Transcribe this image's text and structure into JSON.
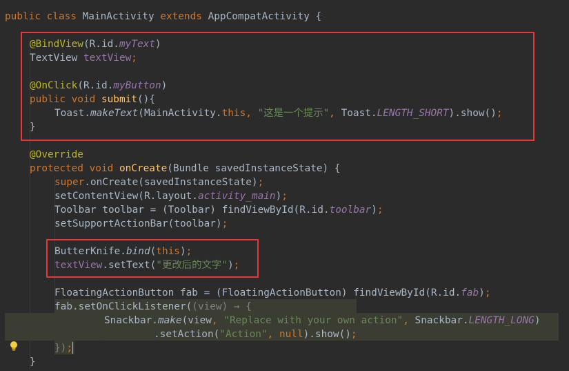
{
  "editor": {
    "lines": [
      {
        "indent": 0,
        "tokens": [
          {
            "t": "public class ",
            "c": "kw"
          },
          {
            "t": "MainActivity ",
            "c": "plain"
          },
          {
            "t": "extends ",
            "c": "kw"
          },
          {
            "t": "AppCompatActivity {",
            "c": "plain"
          }
        ]
      },
      {
        "indent": 0,
        "tokens": []
      },
      {
        "indent": 1,
        "tokens": [
          {
            "t": "@BindView",
            "c": "ann"
          },
          {
            "t": "(R.id.",
            "c": "plain"
          },
          {
            "t": "myText",
            "c": "field"
          },
          {
            "t": ")",
            "c": "plain"
          }
        ]
      },
      {
        "indent": 1,
        "tokens": [
          {
            "t": "TextView ",
            "c": "plain"
          },
          {
            "t": "textView",
            "c": "member"
          },
          {
            "t": ";",
            "c": "kw"
          }
        ]
      },
      {
        "indent": 1,
        "tokens": []
      },
      {
        "indent": 1,
        "tokens": [
          {
            "t": "@OnClick",
            "c": "ann"
          },
          {
            "t": "(R.id.",
            "c": "plain"
          },
          {
            "t": "myButton",
            "c": "field"
          },
          {
            "t": ")",
            "c": "plain"
          }
        ]
      },
      {
        "indent": 1,
        "tokens": [
          {
            "t": "public void ",
            "c": "kw"
          },
          {
            "t": "submit",
            "c": "method"
          },
          {
            "t": "(){",
            "c": "plain"
          }
        ]
      },
      {
        "indent": 2,
        "tokens": [
          {
            "t": "Toast.",
            "c": "plain"
          },
          {
            "t": "makeText",
            "c": "static"
          },
          {
            "t": "(MainActivity.",
            "c": "plain"
          },
          {
            "t": "this",
            "c": "kw"
          },
          {
            "t": ", ",
            "c": "kw"
          },
          {
            "t": "\"这是一个提示\"",
            "c": "str"
          },
          {
            "t": ", ",
            "c": "kw"
          },
          {
            "t": "Toast.",
            "c": "plain"
          },
          {
            "t": "LENGTH_SHORT",
            "c": "field"
          },
          {
            "t": ").show()",
            "c": "plain"
          },
          {
            "t": ";",
            "c": "kw"
          }
        ]
      },
      {
        "indent": 1,
        "tokens": [
          {
            "t": "}",
            "c": "plain"
          }
        ]
      },
      {
        "indent": 1,
        "tokens": []
      },
      {
        "indent": 1,
        "tokens": [
          {
            "t": "@Override",
            "c": "ann"
          }
        ]
      },
      {
        "indent": 1,
        "tokens": [
          {
            "t": "protected void ",
            "c": "kw"
          },
          {
            "t": "onCreate",
            "c": "method"
          },
          {
            "t": "(Bundle savedInstanceState) {",
            "c": "plain"
          }
        ]
      },
      {
        "indent": 2,
        "tokens": [
          {
            "t": "super",
            "c": "kw"
          },
          {
            "t": ".onCreate(savedInstanceState)",
            "c": "plain"
          },
          {
            "t": ";",
            "c": "kw"
          }
        ]
      },
      {
        "indent": 2,
        "tokens": [
          {
            "t": "setContentView(R.layout.",
            "c": "plain"
          },
          {
            "t": "activity_main",
            "c": "field"
          },
          {
            "t": ")",
            "c": "plain"
          },
          {
            "t": ";",
            "c": "kw"
          }
        ]
      },
      {
        "indent": 2,
        "tokens": [
          {
            "t": "Toolbar toolbar = (Toolbar) findViewById(R.id.",
            "c": "plain"
          },
          {
            "t": "toolbar",
            "c": "field"
          },
          {
            "t": ")",
            "c": "plain"
          },
          {
            "t": ";",
            "c": "kw"
          }
        ]
      },
      {
        "indent": 2,
        "tokens": [
          {
            "t": "setSupportActionBar(toolbar)",
            "c": "plain"
          },
          {
            "t": ";",
            "c": "kw"
          }
        ]
      },
      {
        "indent": 2,
        "tokens": []
      },
      {
        "indent": 2,
        "tokens": [
          {
            "t": "ButterKnife.",
            "c": "plain"
          },
          {
            "t": "bind",
            "c": "static"
          },
          {
            "t": "(",
            "c": "plain"
          },
          {
            "t": "this",
            "c": "kw"
          },
          {
            "t": ")",
            "c": "plain"
          },
          {
            "t": ";",
            "c": "kw"
          }
        ]
      },
      {
        "indent": 2,
        "tokens": [
          {
            "t": "textView",
            "c": "member"
          },
          {
            "t": ".setText(",
            "c": "plain"
          },
          {
            "t": "\"更改后的文字\"",
            "c": "str"
          },
          {
            "t": ")",
            "c": "plain"
          },
          {
            "t": ";",
            "c": "kw"
          }
        ]
      },
      {
        "indent": 2,
        "tokens": []
      },
      {
        "indent": 2,
        "tokens": [
          {
            "t": "FloatingActionButton fab = (FloatingActionButton) findViewById(R.id.",
            "c": "plain"
          },
          {
            "t": "fab",
            "c": "field"
          },
          {
            "t": ")",
            "c": "plain"
          },
          {
            "t": ";",
            "c": "kw"
          }
        ]
      },
      {
        "indent": 2,
        "tokens": [
          {
            "t": "fab.setOnClickListener(",
            "c": "plain"
          },
          {
            "t": "(view) → {",
            "c": "dim"
          }
        ]
      },
      {
        "indent": 4,
        "tokens": [
          {
            "t": "Snackbar.",
            "c": "plain"
          },
          {
            "t": "make",
            "c": "static"
          },
          {
            "t": "(view",
            "c": "plain"
          },
          {
            "t": ", ",
            "c": "kw"
          },
          {
            "t": "\"Replace with your own action\"",
            "c": "str"
          },
          {
            "t": ", ",
            "c": "kw"
          },
          {
            "t": "Snackbar.",
            "c": "plain"
          },
          {
            "t": "LENGTH_LONG",
            "c": "field"
          },
          {
            "t": ")",
            "c": "plain"
          }
        ]
      },
      {
        "indent": 6,
        "tokens": [
          {
            "t": ".setAction(",
            "c": "plain"
          },
          {
            "t": "\"Action\"",
            "c": "str"
          },
          {
            "t": ", ",
            "c": "kw"
          },
          {
            "t": "null",
            "c": "kw"
          },
          {
            "t": ").show()",
            "c": "plain"
          },
          {
            "t": ";",
            "c": "kw"
          }
        ]
      },
      {
        "indent": 2,
        "tokens": [
          {
            "t": "})",
            "c": "dim"
          },
          {
            "t": ";",
            "c": "kw"
          }
        ]
      },
      {
        "indent": 1,
        "tokens": [
          {
            "t": "}",
            "c": "plain"
          }
        ]
      }
    ]
  },
  "colors": {
    "background": "#2b2b2b",
    "plain": "#a9b7c6",
    "kw": "#cc7832",
    "ann": "#bbb529",
    "field": "#9876aa",
    "member": "#9876aa",
    "method": "#ffc66d",
    "static": "#a9b7c6",
    "str": "#6a8759",
    "dim": "#808080",
    "highlight": "#3b3d33",
    "box_border": "#e8363a"
  },
  "icons": {
    "intention_bulb": "lightbulb-icon"
  }
}
